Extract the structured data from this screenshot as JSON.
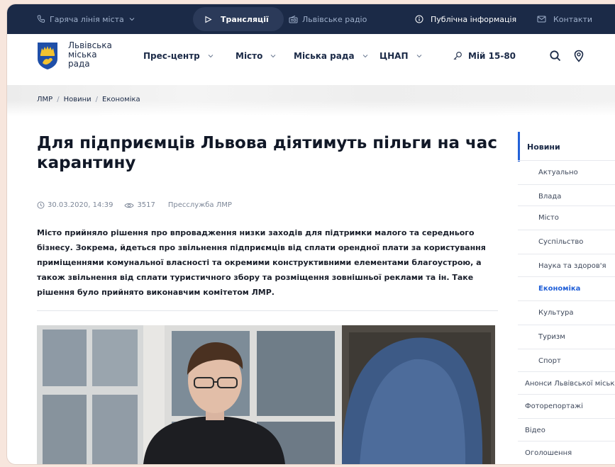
{
  "topbar": {
    "hotline": "Гаряча лінія міста",
    "broadcasts": "Трансляції",
    "radio": "Львівське радіо",
    "public_info": "Публічна інформація",
    "contacts": "Контакти"
  },
  "header": {
    "brand_line1": "Львівська",
    "brand_line2": "міська",
    "brand_line3": "рада",
    "nav": [
      {
        "label": "Прес-центр"
      },
      {
        "label": "Місто"
      },
      {
        "label": "Міська рада"
      },
      {
        "label": "ЦНАП"
      }
    ],
    "hotline_label": "Мій 15-80"
  },
  "breadcrumb": {
    "items": [
      "ЛМР",
      "Новини",
      "Економіка"
    ],
    "separator": "/"
  },
  "article": {
    "title": "Для підприємців Львова діятимуть пільги на час карантину",
    "date": "30.03.2020, 14:39",
    "views": "3517",
    "source": "Пресслужба ЛМР",
    "lead": "Місто прийняло рішення про впровадження низки заходів для підтримки малого та середнього бізнесу. Зокрема, йдеться про звільнення підприємців від сплати орендної плати за користування приміщеннями комунальної власності та окремими конструктивними елементами благоустрою, а також звільнення від сплати туристичного збору та розміщення зовнішньої реклами та ін. Таке рішення було прийнято виконавчим комітетом ЛМР."
  },
  "sidebar": {
    "heading": "Новини",
    "items": [
      {
        "label": "Актуально"
      },
      {
        "label": "Влада"
      },
      {
        "label": "Місто"
      },
      {
        "label": "Суспільство"
      },
      {
        "label": "Наука та здоров'я"
      },
      {
        "label": "Економіка"
      },
      {
        "label": "Культура"
      },
      {
        "label": "Туризм"
      },
      {
        "label": "Спорт"
      },
      {
        "label": "Анонси Львівської міської ради"
      },
      {
        "label": "Фоторепортажі"
      },
      {
        "label": "Відео"
      },
      {
        "label": "Оголошення"
      }
    ]
  },
  "colors": {
    "topbar_bg": "#1b2a47",
    "accent": "#2361d8",
    "title": "#111827",
    "frame_bg": "#f7e6dd"
  },
  "icons": {
    "hotline": "phone-icon",
    "broadcasts": "play-icon",
    "radio": "radio-icon",
    "public_info": "info-icon",
    "contacts": "mail-icon",
    "hotline_nav": "key-icon",
    "search": "search-icon",
    "location": "location-pin-icon",
    "date": "clock-icon",
    "views": "eye-icon"
  }
}
